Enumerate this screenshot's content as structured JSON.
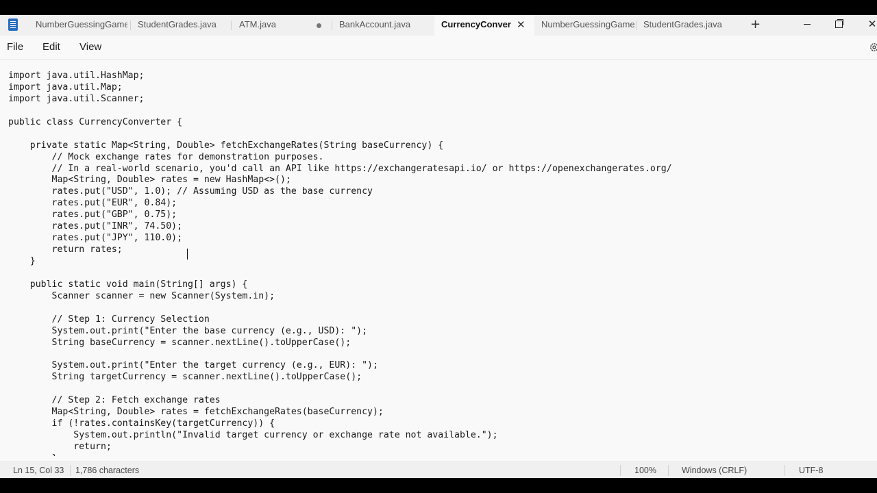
{
  "tabs": [
    {
      "label": "NumberGuessingGame",
      "active": false
    },
    {
      "label": "StudentGrades.java",
      "active": false
    },
    {
      "label": "ATM.java",
      "active": false,
      "unsaved": true
    },
    {
      "label": "BankAccount.java",
      "active": false
    },
    {
      "label": "CurrencyConver",
      "active": true
    },
    {
      "label": "NumberGuessingGame",
      "active": false
    },
    {
      "label": "StudentGrades.java",
      "active": false
    }
  ],
  "tab_close_glyph": "✕",
  "new_tab_glyph": "+",
  "window_controls": {
    "minimize": "minimize-icon",
    "maximize": "maximize-icon",
    "close": "✕"
  },
  "menu": {
    "file": "File",
    "edit": "Edit",
    "view": "View",
    "settings_icon": "gear-icon"
  },
  "code_lines": [
    "import java.util.HashMap;",
    "import java.util.Map;",
    "import java.util.Scanner;",
    "",
    "public class CurrencyConverter {",
    "",
    "    private static Map<String, Double> fetchExchangeRates(String baseCurrency) {",
    "        // Mock exchange rates for demonstration purposes.",
    "        // In a real-world scenario, you'd call an API like https://exchangeratesapi.io/ or https://openexchangerates.org/",
    "        Map<String, Double> rates = new HashMap<>();",
    "        rates.put(\"USD\", 1.0); // Assuming USD as the base currency",
    "        rates.put(\"EUR\", 0.84);",
    "        rates.put(\"GBP\", 0.75);",
    "        rates.put(\"INR\", 74.50);",
    "        rates.put(\"JPY\", 110.0);",
    "        return rates;",
    "    }",
    "",
    "    public static void main(String[] args) {",
    "        Scanner scanner = new Scanner(System.in);",
    "",
    "        // Step 1: Currency Selection",
    "        System.out.print(\"Enter the base currency (e.g., USD): \");",
    "        String baseCurrency = scanner.nextLine().toUpperCase();",
    "",
    "        System.out.print(\"Enter the target currency (e.g., EUR): \");",
    "        String targetCurrency = scanner.nextLine().toUpperCase();",
    "",
    "        // Step 2: Fetch exchange rates",
    "        Map<String, Double> rates = fetchExchangeRates(baseCurrency);",
    "        if (!rates.containsKey(targetCurrency)) {",
    "            System.out.println(\"Invalid target currency or exchange rate not available.\");",
    "            return;",
    "        }"
  ],
  "status": {
    "position": "Ln 15, Col 33",
    "characters": "1,786 characters",
    "zoom": "100%",
    "line_ending": "Windows (CRLF)",
    "encoding": "UTF-8"
  }
}
